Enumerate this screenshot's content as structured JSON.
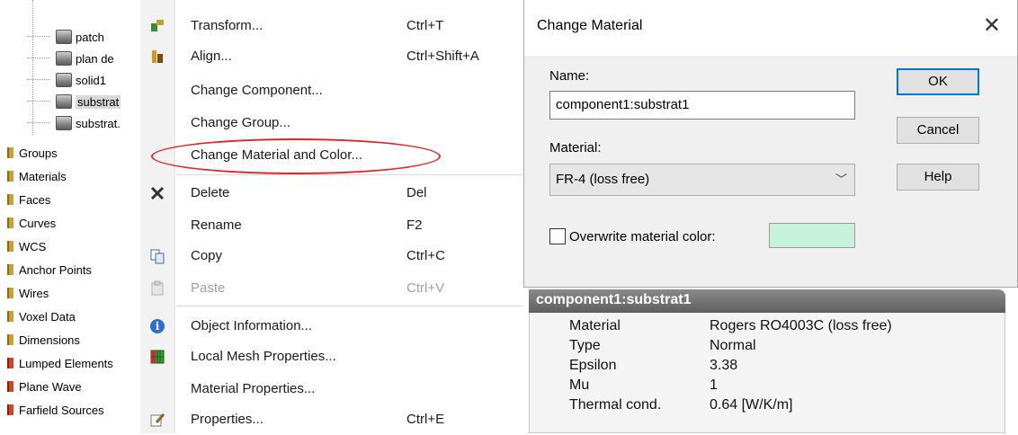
{
  "tree": {
    "children": [
      {
        "label": "patch"
      },
      {
        "label": "plan de"
      },
      {
        "label": "solid1"
      },
      {
        "label": "substrat"
      },
      {
        "label": "substrat."
      }
    ],
    "folders": [
      {
        "label": "Groups"
      },
      {
        "label": "Materials"
      },
      {
        "label": "Faces"
      },
      {
        "label": "Curves"
      },
      {
        "label": "WCS"
      },
      {
        "label": "Anchor Points"
      },
      {
        "label": "Wires"
      },
      {
        "label": "Voxel Data"
      },
      {
        "label": "Dimensions"
      },
      {
        "label": "Lumped Elements"
      },
      {
        "label": "Plane Wave"
      },
      {
        "label": "Farfield Sources"
      }
    ]
  },
  "menu": {
    "items": [
      {
        "label": "Transform...",
        "shortcut": "Ctrl+T",
        "icon": "transform-icon"
      },
      {
        "label": "Align...",
        "shortcut": "Ctrl+Shift+A",
        "icon": "align-icon"
      },
      {
        "label": "Change Component...",
        "shortcut": ""
      },
      {
        "label": "Change Group...",
        "shortcut": ""
      },
      {
        "label": "Change Material and Color...",
        "shortcut": ""
      },
      {
        "label": "Delete",
        "shortcut": "Del",
        "icon": "delete-x-icon"
      },
      {
        "label": "Rename",
        "shortcut": "F2"
      },
      {
        "label": "Copy",
        "shortcut": "Ctrl+C",
        "icon": "copy-icon"
      },
      {
        "label": "Paste",
        "shortcut": "Ctrl+V",
        "icon": "paste-icon",
        "disabled": true
      },
      {
        "label": "Object Information...",
        "shortcut": "",
        "icon": "info-icon"
      },
      {
        "label": "Local Mesh Properties...",
        "shortcut": "",
        "icon": "mesh-icon"
      },
      {
        "label": "Material Properties...",
        "shortcut": ""
      },
      {
        "label": "Properties...",
        "shortcut": "Ctrl+E",
        "icon": "edit-icon"
      }
    ],
    "highlight_color": "#e0242a"
  },
  "dialog": {
    "title": "Change Material",
    "name_label": "Name:",
    "name_value": "component1:substrat1",
    "material_label": "Material:",
    "material_value": "FR-4 (loss free)",
    "overwrite_label": "Overwrite material color:",
    "swatch_color": "#c6f1da",
    "ok_label": "OK",
    "cancel_label": "Cancel",
    "help_label": "Help"
  },
  "properties": {
    "title": "component1:substrat1",
    "rows": [
      {
        "key": "Material",
        "value": "Rogers RO4003C (loss free)"
      },
      {
        "key": "Type",
        "value": "Normal"
      },
      {
        "key": "Epsilon",
        "value": "3.38"
      },
      {
        "key": "Mu",
        "value": "1"
      },
      {
        "key": "Thermal cond.",
        "value": "0.64 [W/K/m]"
      }
    ]
  }
}
